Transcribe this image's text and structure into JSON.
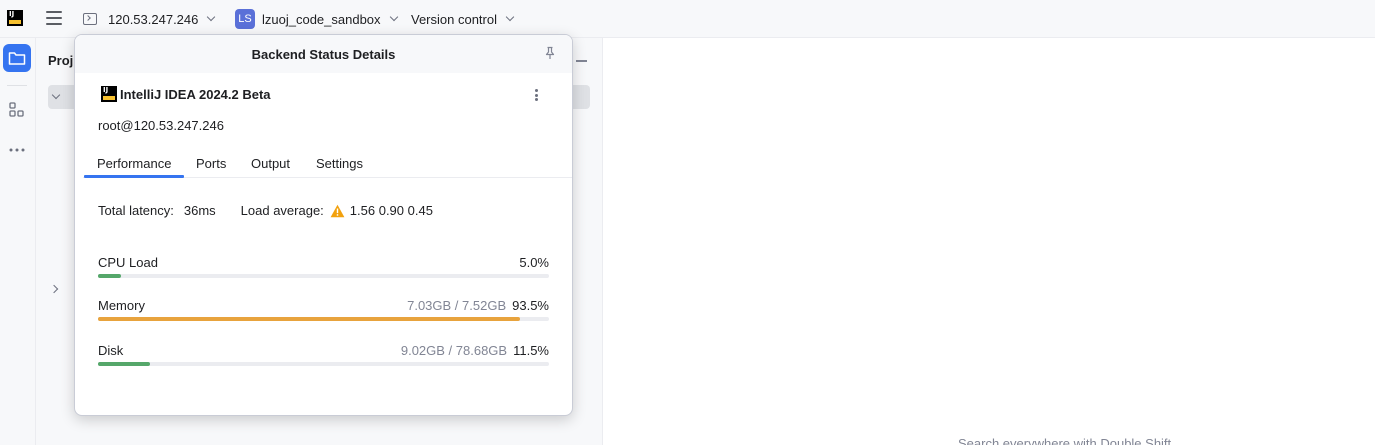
{
  "topbar": {
    "host": "120.53.247.246",
    "project_badge": "LS",
    "project_name": "lzuoj_code_sandbox",
    "vcs": "Version control"
  },
  "project_panel": {
    "title": "Proj"
  },
  "popup": {
    "title": "Backend Status Details",
    "ide_name": "IntelliJ IDEA 2024.2 Beta",
    "host": "root@120.53.247.246",
    "tabs": [
      "Performance",
      "Ports",
      "Output",
      "Settings"
    ],
    "selected_tab": "Performance",
    "latency_label": "Total latency:",
    "latency_value": "36ms",
    "load_label": "Load average:",
    "load_values": "1.56 0.90 0.45",
    "metrics": [
      {
        "label": "CPU Load",
        "usage": "",
        "percent_text": "5.0%",
        "fraction": 0.05,
        "color": "#55a76a"
      },
      {
        "label": "Memory",
        "usage": "7.03GB / 7.52GB",
        "percent_text": "93.5%",
        "fraction": 0.935,
        "color": "#e8a33d"
      },
      {
        "label": "Disk",
        "usage": "9.02GB / 78.68GB",
        "percent_text": "11.5%",
        "fraction": 0.115,
        "color": "#55a76a"
      }
    ]
  },
  "editor": {
    "hint": "Search everywhere with Double Shift"
  },
  "colors": {
    "accent": "#3574f0",
    "warning": "#f2a10e"
  }
}
